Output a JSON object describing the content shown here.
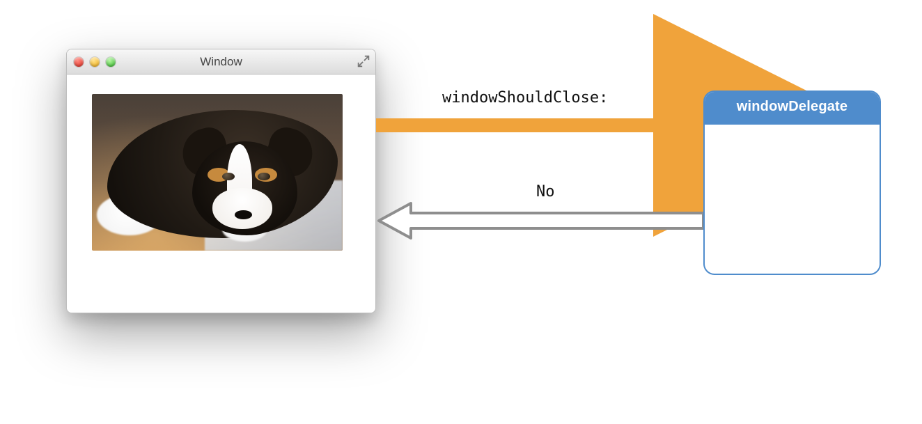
{
  "window": {
    "title": "Window",
    "traffic_lights": {
      "close": "red",
      "minimize": "yellow",
      "zoom": "green"
    },
    "image_subject": "Bernese Mountain Dog puppy lying on a wood floor"
  },
  "delegate_box": {
    "title": "windowDelegate"
  },
  "arrows": {
    "to_delegate": {
      "label": "windowShouldClose:",
      "color": "#f0a33b"
    },
    "to_window": {
      "label": "No",
      "color": "#8e8e8e"
    }
  }
}
